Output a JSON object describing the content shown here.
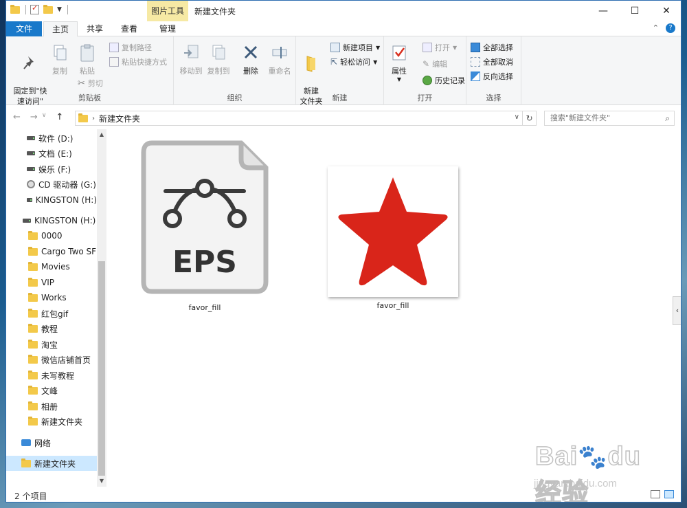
{
  "titlebar": {
    "context_tab": "图片工具",
    "title": "新建文件夹",
    "minimize": "—",
    "maximize": "☐",
    "close": "✕"
  },
  "tabs": [
    {
      "label": "文件"
    },
    {
      "label": "主页"
    },
    {
      "label": "共享"
    },
    {
      "label": "查看"
    },
    {
      "label": "管理"
    }
  ],
  "ribbon": {
    "clipboard": {
      "label": "剪贴板",
      "pin": "固定到\"快\n速访问\"",
      "copy": "复制",
      "paste": "粘贴",
      "copy_path": "复制路径",
      "paste_shortcut": "粘贴快捷方式",
      "cut": "剪切"
    },
    "organize": {
      "label": "组织",
      "move_to": "移动到",
      "copy_to": "复制到",
      "delete": "删除",
      "rename": "重命名"
    },
    "new": {
      "label": "新建",
      "new_folder": "新建\n文件夹",
      "new_item": "新建项目",
      "easy_access": "轻松访问"
    },
    "open": {
      "label": "打开",
      "properties": "属性",
      "open": "打开",
      "edit": "编辑",
      "history": "历史记录"
    },
    "select": {
      "label": "选择",
      "select_all": "全部选择",
      "select_none": "全部取消",
      "invert": "反向选择"
    }
  },
  "address": {
    "crumb": "新建文件夹",
    "search_placeholder": "搜索\"新建文件夹\""
  },
  "nav": [
    {
      "label": "软件 (D:)",
      "icon": "drive-icon"
    },
    {
      "label": "文档 (E:)",
      "icon": "drive-icon"
    },
    {
      "label": "娱乐 (F:)",
      "icon": "drive-icon"
    },
    {
      "label": "CD 驱动器 (G:)",
      "icon": "cd-icon"
    },
    {
      "label": "KINGSTON (H:)",
      "icon": "drive-icon"
    },
    {
      "label": "KINGSTON (H:)",
      "icon": "drive-icon"
    },
    {
      "label": "0000",
      "icon": "folder-icon"
    },
    {
      "label": "Cargo Two SF",
      "icon": "folder-icon"
    },
    {
      "label": "Movies",
      "icon": "folder-icon"
    },
    {
      "label": "VIP",
      "icon": "folder-icon"
    },
    {
      "label": "Works",
      "icon": "folder-icon"
    },
    {
      "label": "红包gif",
      "icon": "folder-icon"
    },
    {
      "label": "教程",
      "icon": "folder-icon"
    },
    {
      "label": "淘宝",
      "icon": "folder-icon"
    },
    {
      "label": "微信店铺首页",
      "icon": "folder-icon"
    },
    {
      "label": "未写教程",
      "icon": "folder-icon"
    },
    {
      "label": "文峰",
      "icon": "folder-icon"
    },
    {
      "label": "相册",
      "icon": "folder-icon"
    },
    {
      "label": "新建文件夹",
      "icon": "folder-icon"
    },
    {
      "label": "网络",
      "icon": "network-icon"
    },
    {
      "label": "新建文件夹",
      "icon": "folder-icon"
    }
  ],
  "files": [
    {
      "name": "favor_fill",
      "type": "EPS",
      "icon": "eps-file-icon"
    },
    {
      "name": "favor_fill",
      "type": "",
      "icon": "red-star-thumbnail"
    }
  ],
  "status": {
    "count": "2 个项目"
  },
  "watermark": {
    "url": "jingyan.baidu.com"
  },
  "colors": {
    "accent": "#1979ca",
    "context_tab": "#f6e9a4",
    "star": "#d9251a",
    "selection": "#cce8ff"
  }
}
